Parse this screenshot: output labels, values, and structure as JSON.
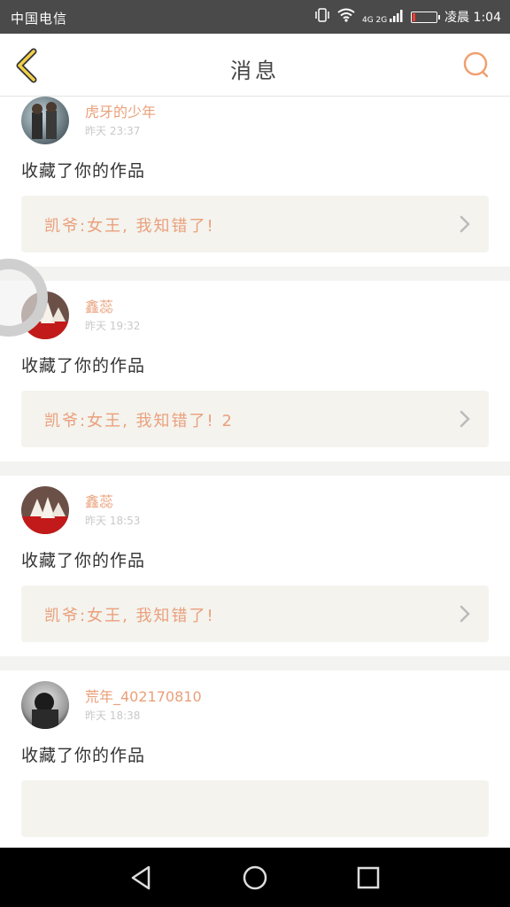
{
  "status_bar": {
    "carrier": "中国电信",
    "time": "凌晨 1:04",
    "network": "4G 2G",
    "battery_level": 0.12,
    "battery_color": "#ff3b30"
  },
  "header": {
    "title": "消息",
    "back_icon": "chevron-left-icon",
    "search_icon": "search-icon",
    "accent_color": "#f0a070"
  },
  "messages": [
    {
      "username": "虎牙的少年",
      "time": "昨天 23:37",
      "action": "收藏了你的作品",
      "work_title": "凯爷:女王, 我知错了!"
    },
    {
      "username": "鑫蕊",
      "time": "昨天 19:32",
      "action": "收藏了你的作品",
      "work_title": "凯爷:女王, 我知错了! 2"
    },
    {
      "username": "鑫蕊",
      "time": "昨天 18:53",
      "action": "收藏了你的作品",
      "work_title": "凯爷:女王, 我知错了!"
    },
    {
      "username": "荒年_402170810",
      "time": "昨天 18:38",
      "action": "收藏了你的作品",
      "work_title": ""
    }
  ],
  "nav": {
    "back_icon": "triangle-back-icon",
    "home_icon": "circle-home-icon",
    "recents_icon": "square-recents-icon"
  }
}
